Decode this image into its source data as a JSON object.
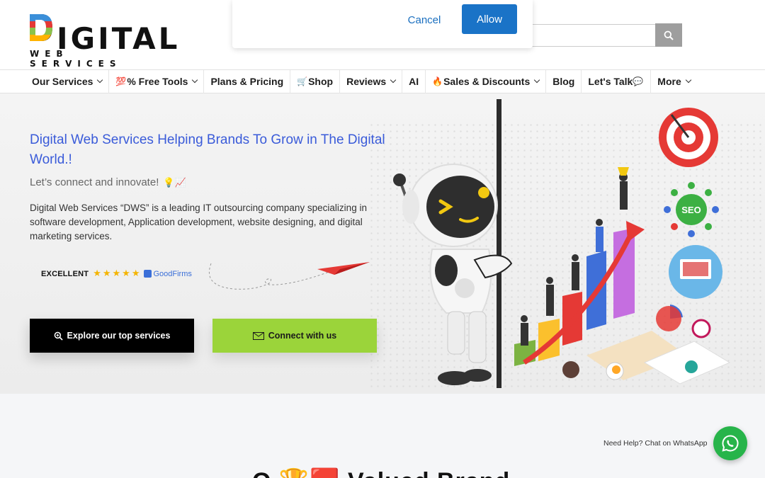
{
  "brand": {
    "logo_main": "IGITAL",
    "logo_sub": "WEB SERVICES"
  },
  "notification": {
    "cancel_label": "Cancel",
    "allow_label": "Allow"
  },
  "search": {
    "placeholder": ""
  },
  "nav": {
    "items": [
      {
        "label": "Our Services",
        "prefix": "",
        "suffix": "",
        "has_dropdown": true
      },
      {
        "label": "% Free Tools",
        "prefix": "💯",
        "suffix": "",
        "has_dropdown": true
      },
      {
        "label": "Plans & Pricing",
        "prefix": "",
        "suffix": "",
        "has_dropdown": false
      },
      {
        "label": "Shop",
        "prefix": "🛒",
        "suffix": "",
        "has_dropdown": false
      },
      {
        "label": "Reviews",
        "prefix": "",
        "suffix": "",
        "has_dropdown": true
      },
      {
        "label": "AI",
        "prefix": "",
        "suffix": "",
        "has_dropdown": false
      },
      {
        "label": "Sales & Discounts",
        "prefix": "🔥",
        "suffix": "",
        "has_dropdown": true
      },
      {
        "label": "Blog",
        "prefix": "",
        "suffix": "",
        "has_dropdown": false
      },
      {
        "label": "Let's Talk",
        "prefix": "",
        "suffix": "💬",
        "has_dropdown": false
      },
      {
        "label": "More",
        "prefix": "",
        "suffix": "",
        "has_dropdown": true
      }
    ]
  },
  "hero": {
    "title": "Digital Web Services Helping Brands To Grow in The Digital World.!",
    "subtitle": "Let’s connect and innovate!",
    "subtitle_emoji": "💡📈",
    "description": "Digital Web Services “DWS” is a leading IT outsourcing company specializing in software development, Application development, website designing, and digital marketing services.",
    "rating_label": "EXCELLENT",
    "rating_stars": 5,
    "rating_source": "GoodFirms",
    "btn_explore": "Explore our top services",
    "btn_connect": "Connect with us",
    "art_badge_seo": "SEO"
  },
  "lower": {
    "heading_partial": "O  🏆🟥  Valued Brand"
  },
  "whatsapp": {
    "label": "Need Help? Chat on WhatsApp"
  },
  "colors": {
    "accent_blue": "#3a5bd9",
    "allow_blue": "#1a73c7",
    "green_button": "#9bd43a",
    "whatsapp_green": "#27b44a",
    "star_gold": "#f4b400"
  }
}
